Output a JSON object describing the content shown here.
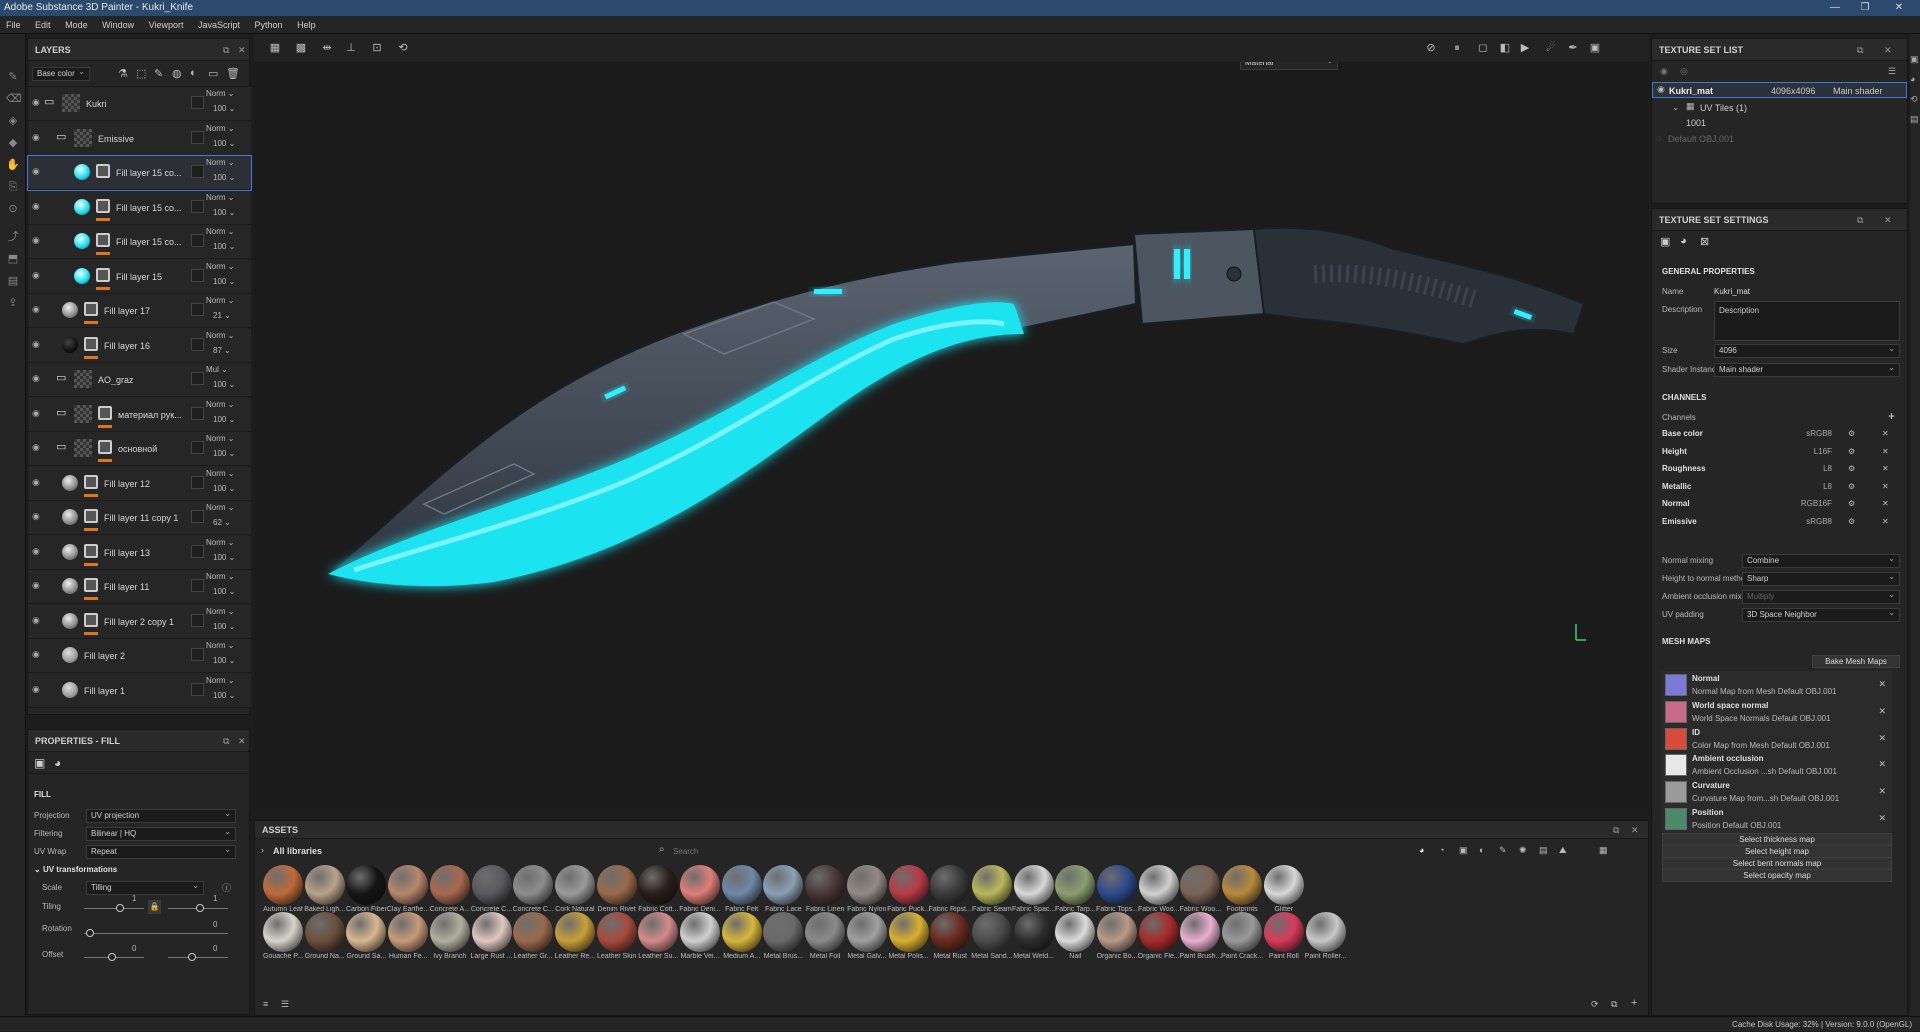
{
  "window": {
    "title": "Adobe Substance 3D Painter - Kukri_Knife"
  },
  "menu": [
    "File",
    "Edit",
    "Mode",
    "Window",
    "Viewport",
    "JavaScript",
    "Python",
    "Help"
  ],
  "layers_panel": {
    "title": "LAYERS",
    "channel_select": "Base color",
    "layers": [
      {
        "name": "Kukri",
        "blend": "Norm",
        "opacity": "100",
        "kind": "folder",
        "indent": 0
      },
      {
        "name": "Emissive",
        "blend": "Norm",
        "opacity": "100",
        "kind": "folder",
        "indent": 1
      },
      {
        "name": "Fill layer 15 co...",
        "blend": "Norm",
        "opacity": "100",
        "kind": "cyan",
        "indent": 2,
        "selected": true,
        "orange": false
      },
      {
        "name": "Fill layer 15 co...",
        "blend": "Norm",
        "opacity": "100",
        "kind": "cyan",
        "indent": 2,
        "orange": true
      },
      {
        "name": "Fill layer 15 co...",
        "blend": "Norm",
        "opacity": "100",
        "kind": "cyan",
        "indent": 2,
        "orange": true
      },
      {
        "name": "Fill layer 15",
        "blend": "Norm",
        "opacity": "100",
        "kind": "cyan",
        "indent": 2,
        "orange": true
      },
      {
        "name": "Fill layer 17",
        "blend": "Norm",
        "opacity": "21",
        "kind": "grey",
        "indent": 1,
        "orange": true
      },
      {
        "name": "Fill layer 16",
        "blend": "Norm",
        "opacity": "87",
        "kind": "dark",
        "indent": 1,
        "orange": true
      },
      {
        "name": "AO_graz",
        "blend": "Mul",
        "opacity": "100",
        "kind": "folder",
        "indent": 1
      },
      {
        "name": "материал рук...",
        "blend": "Norm",
        "opacity": "100",
        "kind": "folder",
        "indent": 1,
        "orange": true
      },
      {
        "name": "основной",
        "blend": "Norm",
        "opacity": "100",
        "kind": "folder",
        "indent": 1,
        "orange": true
      },
      {
        "name": "Fill layer 12",
        "blend": "Norm",
        "opacity": "100",
        "kind": "grey",
        "indent": 1,
        "orange": true
      },
      {
        "name": "Fill layer 11 copy 1",
        "blend": "Norm",
        "opacity": "62",
        "kind": "grey",
        "indent": 1,
        "orange": true
      },
      {
        "name": "Fill layer 13",
        "blend": "Norm",
        "opacity": "100",
        "kind": "grey",
        "indent": 1,
        "orange": true
      },
      {
        "name": "Fill layer 11",
        "blend": "Norm",
        "opacity": "100",
        "kind": "grey",
        "indent": 1,
        "orange": true
      },
      {
        "name": "Fill layer 2 copy 1",
        "blend": "Norm",
        "opacity": "100",
        "kind": "grey",
        "indent": 1,
        "orange": true
      },
      {
        "name": "Fill layer 2",
        "blend": "Norm",
        "opacity": "100",
        "kind": "greyplain",
        "indent": 1
      },
      {
        "name": "Fill layer 1",
        "blend": "Norm",
        "opacity": "100",
        "kind": "greyplain",
        "indent": 1
      }
    ]
  },
  "properties": {
    "title": "PROPERTIES - FILL",
    "section": "FILL",
    "projection_label": "Projection",
    "projection": "UV projection",
    "filtering_label": "Filtering",
    "filtering": "Bilinear | HQ",
    "uvwrap_label": "UV Wrap",
    "uvwrap": "Repeat",
    "uvt_label": "UV transformations",
    "scale_label": "Scale",
    "scale": "Tilling",
    "tiling_label": "Tiling",
    "tiling_val": "1",
    "tiling_val2": "1",
    "rotation_label": "Rotation",
    "rotation_val": "0",
    "offset_label": "Offset",
    "offset_x": "0",
    "offset_y": "0"
  },
  "viewport": {
    "mode_select": "Material"
  },
  "assets": {
    "title": "ASSETS",
    "library": "All libraries",
    "search_placeholder": "Search",
    "row1": [
      "Autumn Leaf",
      "Baked Ligh...",
      "Carbon Fiber",
      "Clay Earthe...",
      "Concrete A...",
      "Concrete C...",
      "Concrete C...",
      "Cork Natural",
      "Denim Rivet",
      "Fabric Cott...",
      "Fabric Deni...",
      "Fabric Felt",
      "Fabric Lace",
      "Fabric Linen",
      "Fabric Nylon",
      "Fabric Puck...",
      "Fabric Ripst...",
      "Fabric Seam",
      "Fabric Spac...",
      "Fabric Tarp...",
      "Fabric Tops...",
      "Fabric Woo...",
      "Fabric Woo...",
      "Footprints",
      "Glitter"
    ],
    "row2": [
      "Gouache P...",
      "Ground Na...",
      "Ground Sa...",
      "Human Fe...",
      "Ivy Branch",
      "Large Rust ...",
      "Leather Gr...",
      "Leather Re...",
      "Leather Skin",
      "Leather Su...",
      "Marble Vei...",
      "Medium A...",
      "Metal Brus...",
      "Metal Foil",
      "Metal Galv...",
      "Metal Polis...",
      "Metal Rust",
      "Metal Sand...",
      "Metal Weld...",
      "Nail",
      "Organic Bo...",
      "Organic Fle...",
      "Paint Brush...",
      "Paint Crack...",
      "Paint Roll",
      "Paint Roller..."
    ],
    "row1_colors": [
      "#c06a3a",
      "#b9a28a",
      "#151515",
      "#b7876a",
      "#a8694e",
      "#5a5a5e",
      "#8d8d8d",
      "#9a9a9a",
      "#9a6a4a",
      "#2a1e18",
      "#e07d77",
      "#6e88a6",
      "#8aa0b4",
      "#4a3636",
      "#938a86",
      "#b83a44",
      "#3a3a3a",
      "#b9b95a",
      "#d8d8d8",
      "#8aa06e",
      "#2c4a8c",
      "#d0d0d0",
      "#7a6456",
      "#b88a3a",
      "#d8d8d8",
      "#d0d0d0"
    ],
    "row2_colors": [
      "#d8d4cc",
      "#6a503c",
      "#d8b890",
      "#c89a7a",
      "#b0b0a0",
      "#e0c8c0",
      "#9a6a4e",
      "#c8a03a",
      "#a84a3a",
      "#d48a8a",
      "#d0d0d0",
      "#d8b83a",
      "#6a6a6a",
      "#8a8a8a",
      "#a0a0a0",
      "#d8b030",
      "#6a2a1e",
      "#4a4a4a",
      "#2c2c2c",
      "#dcdcdc",
      "#b89a86",
      "#a82a2a",
      "#e8b0d0",
      "#9a9a9a",
      "#d83a5a",
      "#c8c8c8"
    ]
  },
  "texture_set_list": {
    "title": "TEXTURE SET LIST",
    "item": "Kukri_mat",
    "item_res": "4096x4096",
    "item_shader": "Main shader",
    "uv_tiles": "UV Tiles (1)",
    "tile": "1001",
    "default_obj": "Default OBJ.001"
  },
  "texture_set_settings": {
    "title": "TEXTURE SET SETTINGS",
    "general": "GENERAL PROPERTIES",
    "name_label": "Name",
    "name": "Kukri_mat",
    "desc_label": "Description",
    "desc": "Description",
    "size_label": "Size",
    "size": "4096",
    "shader_label": "Shader Instance",
    "shader": "Main shader",
    "channels_title": "CHANNELS",
    "channels_label": "Channels",
    "channels": [
      {
        "name": "Base color",
        "fmt": "sRGB8"
      },
      {
        "name": "Height",
        "fmt": "L16F"
      },
      {
        "name": "Roughness",
        "fmt": "L8"
      },
      {
        "name": "Metallic",
        "fmt": "L8"
      },
      {
        "name": "Normal",
        "fmt": "RGB16F"
      },
      {
        "name": "Emissive",
        "fmt": "sRGB8"
      }
    ],
    "normal_mixing_label": "Normal mixing",
    "normal_mixing": "Combine",
    "h2n_label": "Height to normal method",
    "h2n": "Sharp",
    "ao_label": "Ambient occlusion mixing",
    "ao": "Multiply",
    "uvpad_label": "UV padding",
    "uvpad": "3D Space Neighbor",
    "mesh_maps_title": "MESH MAPS",
    "bake_button": "Bake Mesh Maps",
    "mesh_maps": [
      {
        "title": "Normal",
        "sub": "Normal Map from Mesh Default OBJ.001",
        "icon": "#7a7ad8"
      },
      {
        "title": "World space normal",
        "sub": "World Space Normals Default OBJ.001",
        "icon": "#c86a8a"
      },
      {
        "title": "ID",
        "sub": "Color Map from Mesh Default OBJ.001",
        "icon": "#d84a3a"
      },
      {
        "title": "Ambient occlusion",
        "sub": "Ambient Occlusion ...sh Default OBJ.001",
        "icon": "#e8e8e8"
      },
      {
        "title": "Curvature",
        "sub": "Curvature Map from...sh Default OBJ.001",
        "icon": "#9a9a9a"
      },
      {
        "title": "Position",
        "sub": "Position Default OBJ.001",
        "icon": "#4a8a6a"
      }
    ],
    "select_buttons": [
      "Select thickness map",
      "Select height map",
      "Select bent normals map",
      "Select opacity map"
    ]
  },
  "status": {
    "text": "Cache Disk Usage:   32% | Version: 9.0.0 (OpenGL)"
  }
}
